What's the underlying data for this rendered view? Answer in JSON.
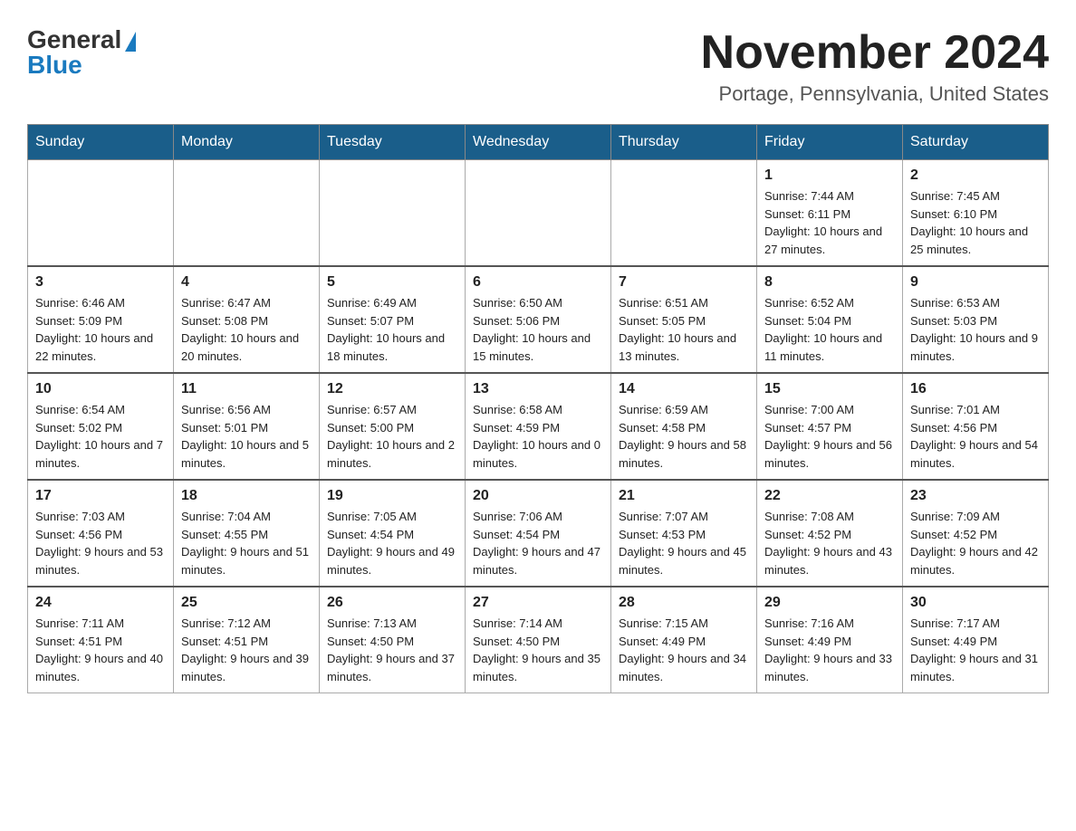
{
  "header": {
    "logo_general": "General",
    "logo_blue": "Blue",
    "month_title": "November 2024",
    "location": "Portage, Pennsylvania, United States"
  },
  "weekdays": [
    "Sunday",
    "Monday",
    "Tuesday",
    "Wednesday",
    "Thursday",
    "Friday",
    "Saturday"
  ],
  "weeks": [
    [
      {
        "day": "",
        "info": ""
      },
      {
        "day": "",
        "info": ""
      },
      {
        "day": "",
        "info": ""
      },
      {
        "day": "",
        "info": ""
      },
      {
        "day": "",
        "info": ""
      },
      {
        "day": "1",
        "info": "Sunrise: 7:44 AM\nSunset: 6:11 PM\nDaylight: 10 hours and 27 minutes."
      },
      {
        "day": "2",
        "info": "Sunrise: 7:45 AM\nSunset: 6:10 PM\nDaylight: 10 hours and 25 minutes."
      }
    ],
    [
      {
        "day": "3",
        "info": "Sunrise: 6:46 AM\nSunset: 5:09 PM\nDaylight: 10 hours and 22 minutes."
      },
      {
        "day": "4",
        "info": "Sunrise: 6:47 AM\nSunset: 5:08 PM\nDaylight: 10 hours and 20 minutes."
      },
      {
        "day": "5",
        "info": "Sunrise: 6:49 AM\nSunset: 5:07 PM\nDaylight: 10 hours and 18 minutes."
      },
      {
        "day": "6",
        "info": "Sunrise: 6:50 AM\nSunset: 5:06 PM\nDaylight: 10 hours and 15 minutes."
      },
      {
        "day": "7",
        "info": "Sunrise: 6:51 AM\nSunset: 5:05 PM\nDaylight: 10 hours and 13 minutes."
      },
      {
        "day": "8",
        "info": "Sunrise: 6:52 AM\nSunset: 5:04 PM\nDaylight: 10 hours and 11 minutes."
      },
      {
        "day": "9",
        "info": "Sunrise: 6:53 AM\nSunset: 5:03 PM\nDaylight: 10 hours and 9 minutes."
      }
    ],
    [
      {
        "day": "10",
        "info": "Sunrise: 6:54 AM\nSunset: 5:02 PM\nDaylight: 10 hours and 7 minutes."
      },
      {
        "day": "11",
        "info": "Sunrise: 6:56 AM\nSunset: 5:01 PM\nDaylight: 10 hours and 5 minutes."
      },
      {
        "day": "12",
        "info": "Sunrise: 6:57 AM\nSunset: 5:00 PM\nDaylight: 10 hours and 2 minutes."
      },
      {
        "day": "13",
        "info": "Sunrise: 6:58 AM\nSunset: 4:59 PM\nDaylight: 10 hours and 0 minutes."
      },
      {
        "day": "14",
        "info": "Sunrise: 6:59 AM\nSunset: 4:58 PM\nDaylight: 9 hours and 58 minutes."
      },
      {
        "day": "15",
        "info": "Sunrise: 7:00 AM\nSunset: 4:57 PM\nDaylight: 9 hours and 56 minutes."
      },
      {
        "day": "16",
        "info": "Sunrise: 7:01 AM\nSunset: 4:56 PM\nDaylight: 9 hours and 54 minutes."
      }
    ],
    [
      {
        "day": "17",
        "info": "Sunrise: 7:03 AM\nSunset: 4:56 PM\nDaylight: 9 hours and 53 minutes."
      },
      {
        "day": "18",
        "info": "Sunrise: 7:04 AM\nSunset: 4:55 PM\nDaylight: 9 hours and 51 minutes."
      },
      {
        "day": "19",
        "info": "Sunrise: 7:05 AM\nSunset: 4:54 PM\nDaylight: 9 hours and 49 minutes."
      },
      {
        "day": "20",
        "info": "Sunrise: 7:06 AM\nSunset: 4:54 PM\nDaylight: 9 hours and 47 minutes."
      },
      {
        "day": "21",
        "info": "Sunrise: 7:07 AM\nSunset: 4:53 PM\nDaylight: 9 hours and 45 minutes."
      },
      {
        "day": "22",
        "info": "Sunrise: 7:08 AM\nSunset: 4:52 PM\nDaylight: 9 hours and 43 minutes."
      },
      {
        "day": "23",
        "info": "Sunrise: 7:09 AM\nSunset: 4:52 PM\nDaylight: 9 hours and 42 minutes."
      }
    ],
    [
      {
        "day": "24",
        "info": "Sunrise: 7:11 AM\nSunset: 4:51 PM\nDaylight: 9 hours and 40 minutes."
      },
      {
        "day": "25",
        "info": "Sunrise: 7:12 AM\nSunset: 4:51 PM\nDaylight: 9 hours and 39 minutes."
      },
      {
        "day": "26",
        "info": "Sunrise: 7:13 AM\nSunset: 4:50 PM\nDaylight: 9 hours and 37 minutes."
      },
      {
        "day": "27",
        "info": "Sunrise: 7:14 AM\nSunset: 4:50 PM\nDaylight: 9 hours and 35 minutes."
      },
      {
        "day": "28",
        "info": "Sunrise: 7:15 AM\nSunset: 4:49 PM\nDaylight: 9 hours and 34 minutes."
      },
      {
        "day": "29",
        "info": "Sunrise: 7:16 AM\nSunset: 4:49 PM\nDaylight: 9 hours and 33 minutes."
      },
      {
        "day": "30",
        "info": "Sunrise: 7:17 AM\nSunset: 4:49 PM\nDaylight: 9 hours and 31 minutes."
      }
    ]
  ]
}
